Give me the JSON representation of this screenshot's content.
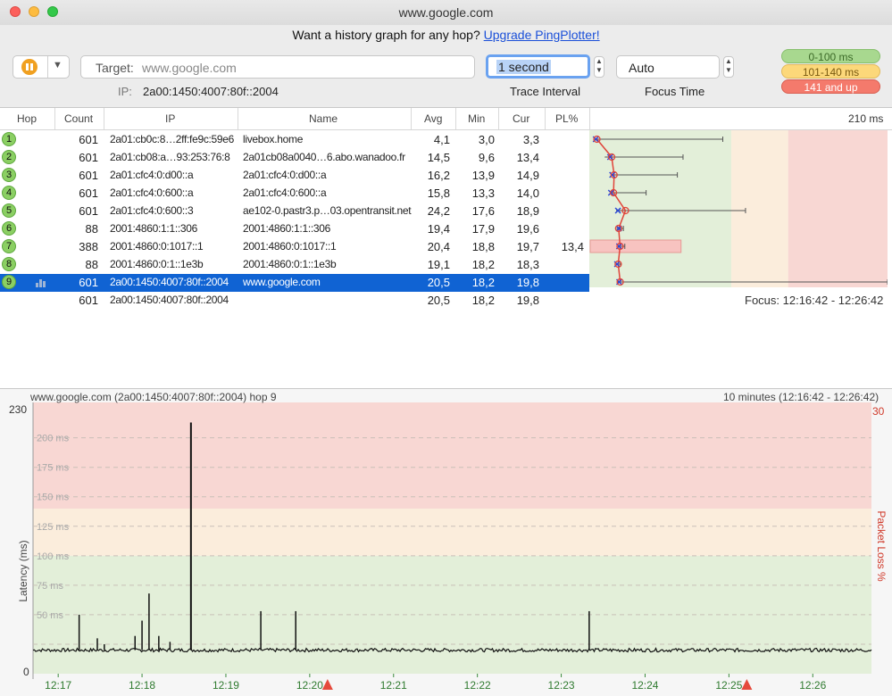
{
  "window": {
    "title": "www.google.com"
  },
  "promo": {
    "text": "Want a history graph for any hop?",
    "link": "Upgrade PingPlotter!"
  },
  "toolbar": {
    "target_label": "Target:",
    "target_value": "www.google.com",
    "ip_label": "IP:",
    "ip_value": "2a00:1450:4007:80f::2004",
    "trace_interval_value": "1 second",
    "trace_interval_caption": "Trace Interval",
    "focus_time_value": "Auto",
    "focus_time_caption": "Focus Time"
  },
  "latency_legend": [
    {
      "label": "0-100 ms",
      "color": "#a8d88f"
    },
    {
      "label": "101-140 ms",
      "color": "#fcd87a"
    },
    {
      "label": "141 and up",
      "color": "#f47a6c"
    }
  ],
  "table": {
    "columns": [
      "Hop",
      "Count",
      "IP",
      "Name",
      "Avg",
      "Min",
      "Cur",
      "PL%"
    ],
    "scale_max_label": "210 ms",
    "rows": [
      {
        "hop": "1",
        "count": "601",
        "ip": "2a01:cb0c:8…2ff:fe9c:59e6",
        "name": "livebox.home",
        "avg": "4,1",
        "min": "3,0",
        "cur": "3,3",
        "pl": ""
      },
      {
        "hop": "2",
        "count": "601",
        "ip": "2a01:cb08:a…93:253:76:8",
        "name": "2a01cb08a0040…6.abo.wanadoo.fr",
        "avg": "14,5",
        "min": "9,6",
        "cur": "13,4",
        "pl": ""
      },
      {
        "hop": "3",
        "count": "601",
        "ip": "2a01:cfc4:0:d00::a",
        "name": "2a01:cfc4:0:d00::a",
        "avg": "16,2",
        "min": "13,9",
        "cur": "14,9",
        "pl": ""
      },
      {
        "hop": "4",
        "count": "601",
        "ip": "2a01:cfc4:0:600::a",
        "name": "2a01:cfc4:0:600::a",
        "avg": "15,8",
        "min": "13,3",
        "cur": "14,0",
        "pl": ""
      },
      {
        "hop": "5",
        "count": "601",
        "ip": "2a01:cfc4:0:600::3",
        "name": "ae102-0.pastr3.p…03.opentransit.net",
        "avg": "24,2",
        "min": "17,6",
        "cur": "18,9",
        "pl": ""
      },
      {
        "hop": "6",
        "count": "88",
        "ip": "2001:4860:1:1::306",
        "name": "2001:4860:1:1::306",
        "avg": "19,4",
        "min": "17,9",
        "cur": "19,6",
        "pl": ""
      },
      {
        "hop": "7",
        "count": "388",
        "ip": "2001:4860:0:1017::1",
        "name": "2001:4860:0:1017::1",
        "avg": "20,4",
        "min": "18,8",
        "cur": "19,7",
        "pl": "13,4"
      },
      {
        "hop": "8",
        "count": "88",
        "ip": "2001:4860:0:1::1e3b",
        "name": "2001:4860:0:1::1e3b",
        "avg": "19,1",
        "min": "18,2",
        "cur": "18,3",
        "pl": ""
      },
      {
        "hop": "9",
        "count": "601",
        "ip": "2a00:1450:4007:80f::2004",
        "name": "www.google.com",
        "avg": "20,5",
        "min": "18,2",
        "cur": "19,8",
        "pl": "",
        "selected": true
      }
    ],
    "summary": {
      "count": "601",
      "ip": "2a00:1450:4007:80f::2004",
      "avg": "20,5",
      "min": "18,2",
      "cur": "19,8"
    },
    "focus_range": "Focus: 12:16:42 - 12:26:42"
  },
  "graph": {
    "title": "www.google.com (2a00:1450:4007:80f::2004) hop 9",
    "range_label": "10 minutes (12:16:42 - 12:26:42)",
    "y_axis_label": "Latency (ms)",
    "right_axis_label": "Packet Loss %",
    "y_top_label": "230",
    "y_bottom_label": "0",
    "right_top_label": "30",
    "ms_ticks": [
      "200 ms",
      "175 ms",
      "150 ms",
      "125 ms",
      "100 ms",
      "75 ms",
      "50 ms"
    ],
    "time_ticks": [
      "12:17",
      "12:18",
      "12:19",
      "12:20",
      "12:21",
      "12:22",
      "12:23",
      "12:24",
      "12:25",
      "12:26"
    ]
  },
  "chart_data": {
    "type": "line",
    "title": "www.google.com (2a00:1450:4007:80f::2004) hop 9",
    "ylabel": "Latency (ms)",
    "y2label": "Packet Loss %",
    "ylim": [
      0,
      230
    ],
    "y2lim": [
      0,
      30
    ],
    "zones": [
      {
        "from": 0,
        "to": 100,
        "color": "#e3efd9"
      },
      {
        "from": 100,
        "to": 140,
        "color": "#fbeddc"
      },
      {
        "from": 140,
        "to": 230,
        "color": "#f8d7d3"
      }
    ],
    "x_ticks": [
      "12:17",
      "12:18",
      "12:19",
      "12:20",
      "12:21",
      "12:22",
      "12:23",
      "12:24",
      "12:25",
      "12:26"
    ],
    "loss_markers": [
      "12:20",
      "12:25"
    ],
    "baseline_ms": 20,
    "spikes": [
      {
        "time": "12:17:15",
        "ms": 50
      },
      {
        "time": "12:17:28",
        "ms": 30
      },
      {
        "time": "12:17:33",
        "ms": 25
      },
      {
        "time": "12:17:55",
        "ms": 32
      },
      {
        "time": "12:18:00",
        "ms": 45
      },
      {
        "time": "12:18:05",
        "ms": 68
      },
      {
        "time": "12:18:12",
        "ms": 32
      },
      {
        "time": "12:18:20",
        "ms": 27
      },
      {
        "time": "12:18:35",
        "ms": 213
      },
      {
        "time": "12:19:25",
        "ms": 53
      },
      {
        "time": "12:19:50",
        "ms": 53
      },
      {
        "time": "12:23:20",
        "ms": 53
      }
    ],
    "mini_chart": {
      "scale_max": 210,
      "hops": [
        {
          "hop": 1,
          "min": 3.0,
          "avg": 4.1,
          "cur": 3.3,
          "max": 94
        },
        {
          "hop": 2,
          "min": 9.6,
          "avg": 14.5,
          "cur": 13.4,
          "max": 66
        },
        {
          "hop": 3,
          "min": 13.9,
          "avg": 16.2,
          "cur": 14.9,
          "max": 62
        },
        {
          "hop": 4,
          "min": 13.3,
          "avg": 15.8,
          "cur": 14.0,
          "max": 40
        },
        {
          "hop": 5,
          "min": 17.6,
          "avg": 24.2,
          "cur": 18.9,
          "max": 110
        },
        {
          "hop": 6,
          "min": 17.9,
          "avg": 19.4,
          "cur": 19.6,
          "max": 24
        },
        {
          "hop": 7,
          "min": 18.8,
          "avg": 20.4,
          "cur": 19.7,
          "max": 25,
          "loss": 13.4
        },
        {
          "hop": 8,
          "min": 18.2,
          "avg": 19.1,
          "cur": 18.3,
          "max": 22
        },
        {
          "hop": 9,
          "min": 18.2,
          "avg": 20.5,
          "cur": 19.8,
          "max": 210
        }
      ]
    }
  }
}
